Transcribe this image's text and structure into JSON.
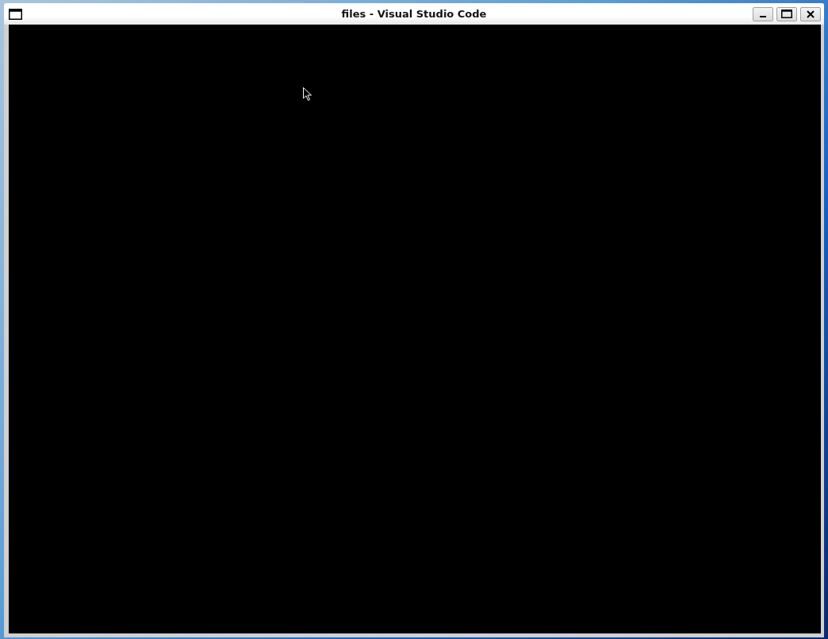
{
  "window": {
    "title": "files - Visual Studio Code"
  }
}
